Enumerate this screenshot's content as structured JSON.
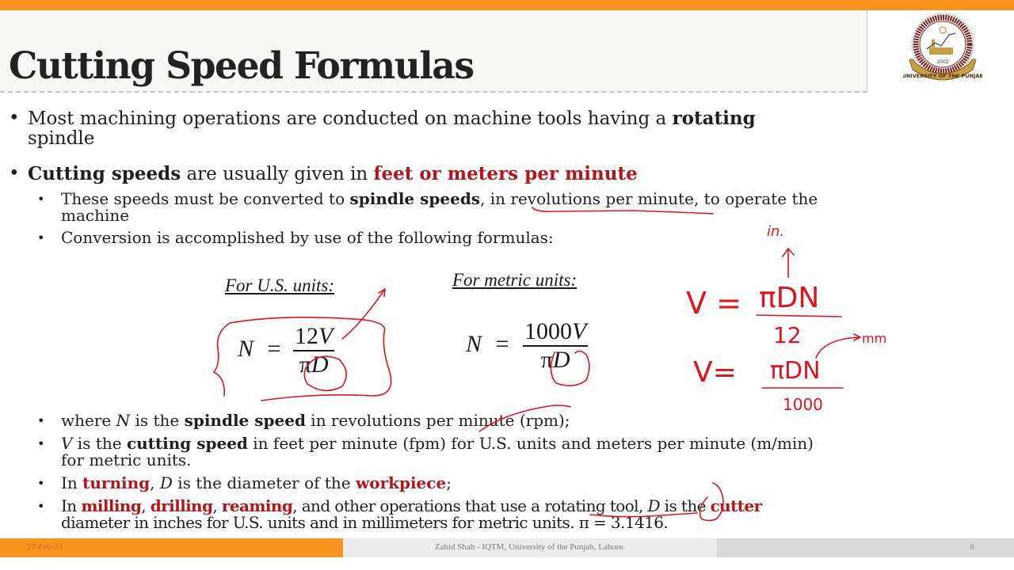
{
  "slide": {
    "title": "Cutting Speed Formulas",
    "logo": {
      "icon": "university-seal-icon",
      "ring_text": "Institute of Quality & Technology Management",
      "year": "2002",
      "banner_text": "UNIVERSITY OF THE PUNJAB",
      "colors": {
        "ring": "#7a1e1e",
        "banner": "#c8a043"
      }
    },
    "bullets": {
      "b1": {
        "pre": "Most machining operations are conducted on machine tools having a ",
        "bold": "rotating",
        "line2": "spindle"
      },
      "b2": {
        "bold": "Cutting speeds",
        "mid": " are usually given in ",
        "red": "feet or meters per minute"
      },
      "s1": {
        "pre": "These speeds must be converted to ",
        "bold": "spindle speeds",
        "post": ", in revolutions per minute, to operate the",
        "line2": "machine"
      },
      "s2": {
        "text": "Conversion is accomplished by use of the following formulas:"
      },
      "s3": {
        "pre": "where ",
        "var": "N",
        "mid": " is the ",
        "bold": "spindle speed",
        "post": " in revolutions per minute (rpm);"
      },
      "s4": {
        "var": "V",
        "mid": " is the ",
        "bold": "cutting speed",
        "post": " in feet per minute (fpm) for U.S. units and meters per minute (m/min)",
        "line2": "for metric units."
      },
      "s5": {
        "pre": "In ",
        "red1": "turning",
        "sep": ", ",
        "var": "D",
        "mid": " is the diameter of the ",
        "red2": "workpiece",
        "post": ";"
      },
      "s6": {
        "pre": "In ",
        "red1": "milling",
        "c1": ", ",
        "red2": "drilling",
        "c2": ", ",
        "red3": "reaming",
        "mid": ", and other operations that use a rotating tool, ",
        "var": "D",
        "mid2": " is the ",
        "red4": "cutter",
        "line2": "diameter in inches for U.S. units and in millimeters for metric units. π = 3.1416."
      }
    },
    "formulas": {
      "us": {
        "label": "For U.S. units:",
        "lhs": "N",
        "eq": "=",
        "num_coef": "12",
        "num_var": "V",
        "den_pi": "π",
        "den_var": "D"
      },
      "metric": {
        "label": "For metric units:",
        "lhs": "N",
        "eq": "=",
        "num_coef": "1000",
        "num_var": "V",
        "den_pi": "π",
        "den_var": "D"
      }
    },
    "annotations": {
      "in_label": "in.",
      "mm_label": "mm",
      "eq1": {
        "lhs": "V =",
        "num": "πDN",
        "den": "12"
      },
      "eq2": {
        "lhs": "V=",
        "num": "πDN",
        "den": "1000"
      },
      "ink_color": "#e0141e"
    },
    "accent_colors": {
      "orange": "#f7931e",
      "red_text": "#b4141a"
    }
  },
  "footer": {
    "date": "27-Feb-21",
    "center": "Zahid Shah - IQTM, University of the Punjab, Lahore.",
    "page": "6"
  }
}
